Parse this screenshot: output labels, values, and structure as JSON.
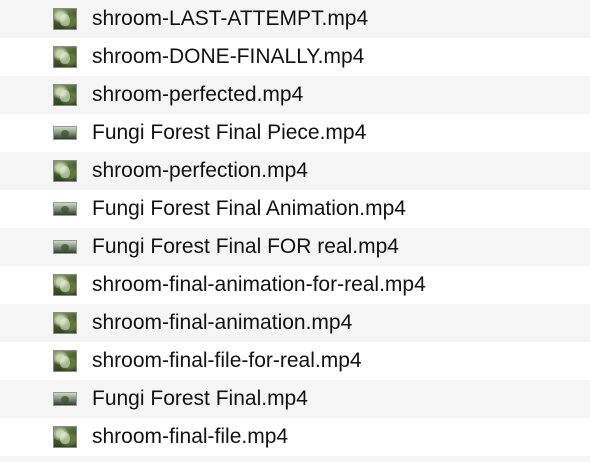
{
  "files": [
    {
      "name": "shroom-LAST-ATTEMPT.mp4",
      "icon": "video-thumbnail-icon"
    },
    {
      "name": "shroom-DONE-FINALLY.mp4",
      "icon": "video-thumbnail-icon"
    },
    {
      "name": "shroom-perfected.mp4",
      "icon": "video-thumbnail-icon"
    },
    {
      "name": "Fungi Forest Final Piece.mp4",
      "icon": "video-thumbnail-wide-icon"
    },
    {
      "name": "shroom-perfection.mp4",
      "icon": "video-thumbnail-icon"
    },
    {
      "name": "Fungi Forest Final Animation.mp4",
      "icon": "video-thumbnail-wide-icon"
    },
    {
      "name": "Fungi Forest Final FOR real.mp4",
      "icon": "video-thumbnail-wide-icon"
    },
    {
      "name": "shroom-final-animation-for-real.mp4",
      "icon": "video-thumbnail-icon"
    },
    {
      "name": "shroom-final-animation.mp4",
      "icon": "video-thumbnail-icon"
    },
    {
      "name": "shroom-final-file-for-real.mp4",
      "icon": "video-thumbnail-icon"
    },
    {
      "name": "Fungi Forest Final.mp4",
      "icon": "video-thumbnail-wide-icon"
    },
    {
      "name": "shroom-final-file.mp4",
      "icon": "video-thumbnail-icon"
    }
  ]
}
